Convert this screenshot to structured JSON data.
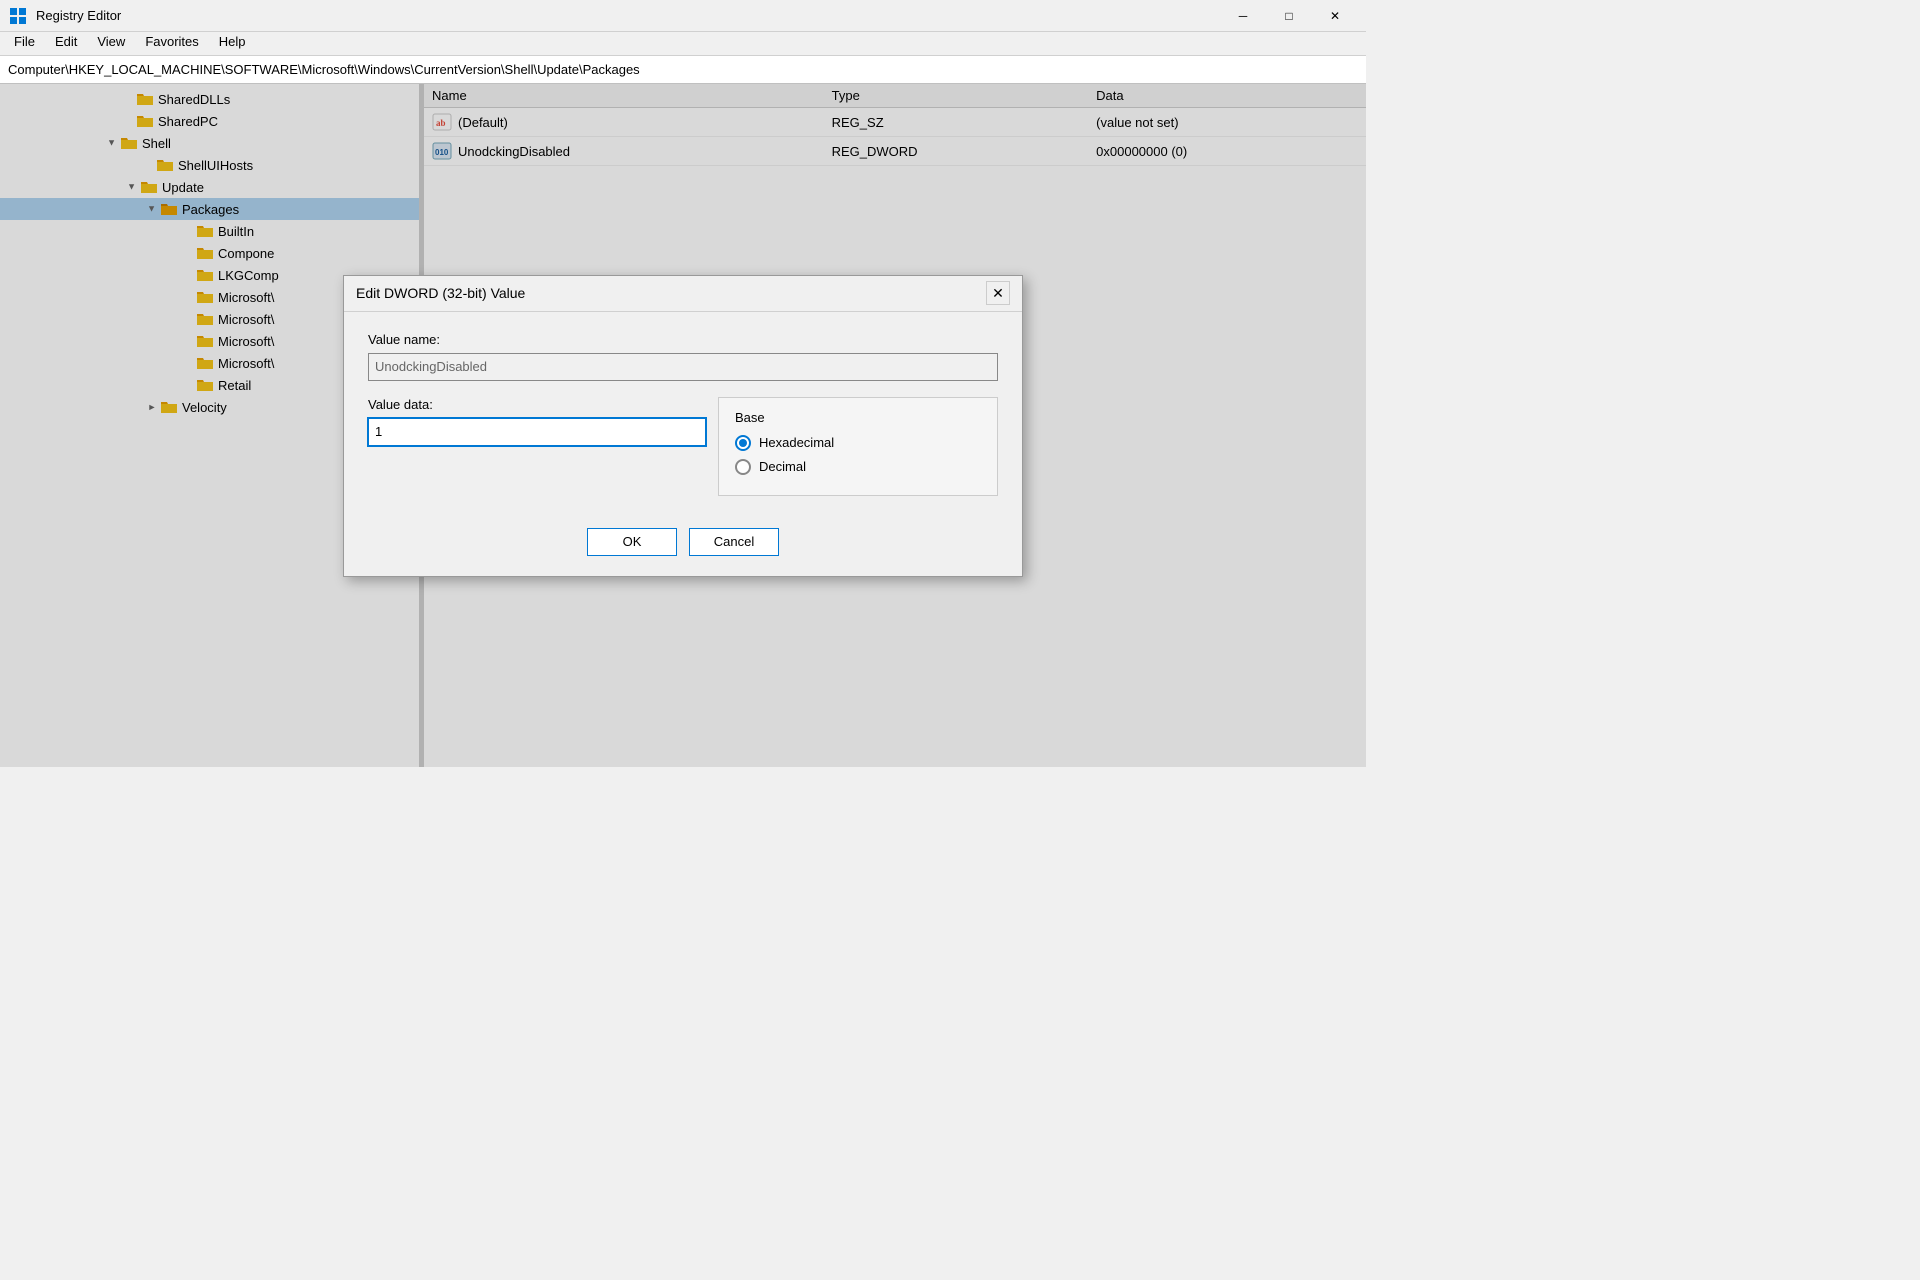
{
  "window": {
    "title": "Registry Editor",
    "icon": "registry-icon"
  },
  "titlebar": {
    "minimize_label": "─",
    "maximize_label": "□",
    "close_label": "✕"
  },
  "menubar": {
    "items": [
      "File",
      "Edit",
      "View",
      "Favorites",
      "Help"
    ]
  },
  "address": {
    "path": "Computer\\HKEY_LOCAL_MACHINE\\SOFTWARE\\Microsoft\\Windows\\CurrentVersion\\Shell\\Update\\Packages"
  },
  "tree": {
    "items": [
      {
        "label": "SharedDLLs",
        "depth": 1,
        "expanded": false,
        "hasChildren": false
      },
      {
        "label": "SharedPC",
        "depth": 1,
        "expanded": false,
        "hasChildren": false
      },
      {
        "label": "Shell",
        "depth": 1,
        "expanded": true,
        "hasChildren": true
      },
      {
        "label": "ShellUIHosts",
        "depth": 2,
        "expanded": false,
        "hasChildren": false
      },
      {
        "label": "Update",
        "depth": 2,
        "expanded": true,
        "hasChildren": true
      },
      {
        "label": "Packages",
        "depth": 3,
        "expanded": true,
        "hasChildren": true,
        "selected": true
      },
      {
        "label": "BuiltIn",
        "depth": 4,
        "expanded": false,
        "hasChildren": false
      },
      {
        "label": "Compone",
        "depth": 4,
        "expanded": false,
        "hasChildren": false
      },
      {
        "label": "LKGComp",
        "depth": 4,
        "expanded": false,
        "hasChildren": false
      },
      {
        "label": "Microsoft\\",
        "depth": 4,
        "expanded": false,
        "hasChildren": false
      },
      {
        "label": "Microsoft\\",
        "depth": 4,
        "expanded": false,
        "hasChildren": false
      },
      {
        "label": "Microsoft\\",
        "depth": 4,
        "expanded": false,
        "hasChildren": false
      },
      {
        "label": "Microsoft\\",
        "depth": 4,
        "expanded": false,
        "hasChildren": false
      },
      {
        "label": "Retail",
        "depth": 4,
        "expanded": false,
        "hasChildren": false
      },
      {
        "label": "Velocity",
        "depth": 3,
        "expanded": false,
        "hasChildren": true,
        "collapsed": true
      }
    ]
  },
  "registry_table": {
    "columns": [
      "Name",
      "Type",
      "Data"
    ],
    "rows": [
      {
        "icon": "ab-icon",
        "name": "(Default)",
        "type": "REG_SZ",
        "data": "(value not set)"
      },
      {
        "icon": "dword-icon",
        "name": "UnodckingDisabled",
        "type": "REG_DWORD",
        "data": "0x00000000 (0)"
      }
    ]
  },
  "dialog": {
    "title": "Edit DWORD (32-bit) Value",
    "value_name_label": "Value name:",
    "value_name": "UnodckingDisabled",
    "value_data_label": "Value data:",
    "value_data": "1",
    "base_label": "Base",
    "base_options": [
      {
        "label": "Hexadecimal",
        "selected": true
      },
      {
        "label": "Decimal",
        "selected": false
      }
    ],
    "ok_label": "OK",
    "cancel_label": "Cancel"
  }
}
